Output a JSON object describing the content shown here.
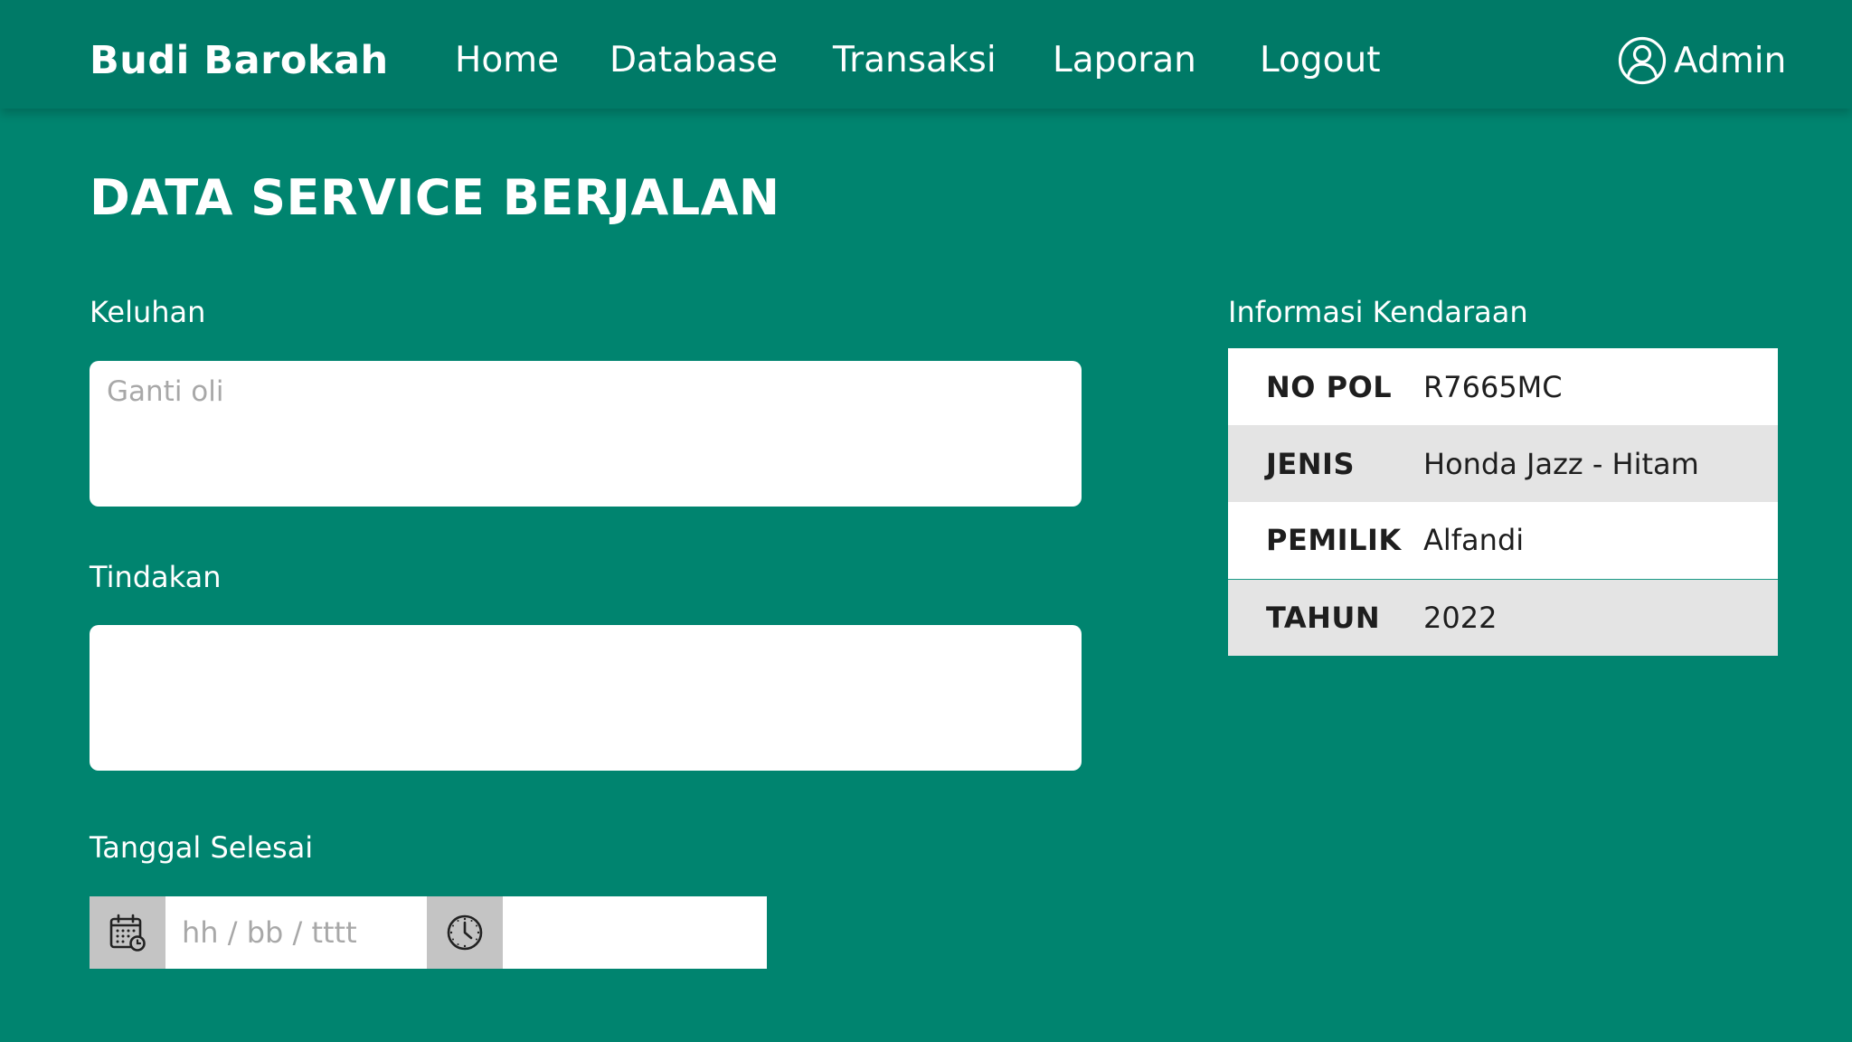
{
  "brand": "Budi Barokah",
  "nav": {
    "home": "Home",
    "database": "Database",
    "transaksi": "Transaksi",
    "laporan": "Laporan",
    "logout": "Logout"
  },
  "user": {
    "label": "Admin",
    "icon": "user-circle-icon"
  },
  "page_title": "DATA SERVICE BERJALAN",
  "form": {
    "keluhan": {
      "label": "Keluhan",
      "placeholder": "Ganti oli",
      "value": ""
    },
    "tindakan": {
      "label": "Tindakan",
      "placeholder": "",
      "value": ""
    },
    "tanggal_selesai": {
      "label": "Tanggal Selesai",
      "date_placeholder": "hh / bb / tttt",
      "time_placeholder": "",
      "date_icon": "calendar-icon",
      "time_icon": "clock-icon"
    }
  },
  "vehicle_info": {
    "title": "Informasi Kendaraan",
    "rows": [
      {
        "key": "NO POL",
        "value": "R7665MC"
      },
      {
        "key": "JENIS",
        "value": "Honda Jazz - Hitam"
      },
      {
        "key": "PEMILIK",
        "value": "Alfandi"
      },
      {
        "key": "TAHUN",
        "value": "2022"
      }
    ]
  },
  "colors": {
    "background": "#00846f",
    "navbar": "#007a67",
    "table_row_alt": "#e4e4e4",
    "icon_box": "#c4c4c4"
  }
}
